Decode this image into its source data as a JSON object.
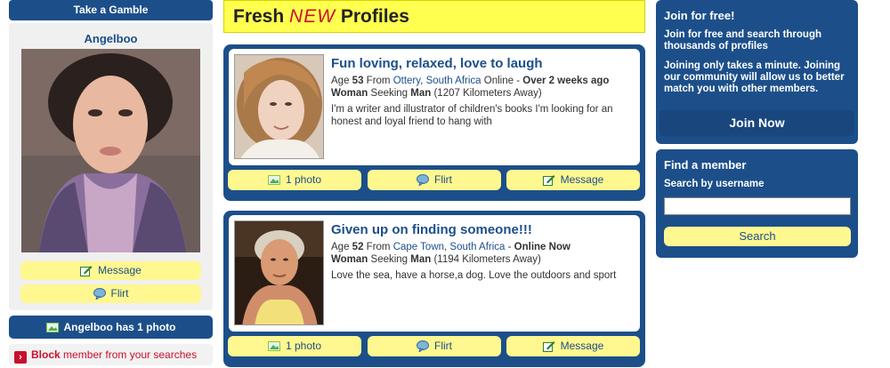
{
  "left": {
    "gamble_label": "Take a Gamble",
    "featured_name": "Angelboo",
    "message_label": "Message",
    "flirt_label": "Flirt",
    "photo_count_label": "Angelboo has 1 photo",
    "block_word": "Block",
    "block_rest": " member from your searches"
  },
  "header": {
    "fresh": "Fresh ",
    "new": "NEW",
    "profiles": " Profiles"
  },
  "profiles": [
    {
      "headline": "Fun loving, relaxed, love to laugh",
      "age_label": "Age ",
      "age": "53",
      "from_label": " From ",
      "city": "Ottery",
      "country": "South Africa",
      "online_label": " Online - ",
      "online_status": "Over 2 weeks ago",
      "gender": "Woman",
      "seeking_label": " Seeking ",
      "seeking": "Man",
      "distance": " (1207 Kilometers Away)",
      "description": "I'm a writer and illustrator of children's books I'm looking for an honest and loyal friend to hang with",
      "photo_btn": "1 photo",
      "flirt_btn": "Flirt",
      "message_btn": "Message"
    },
    {
      "headline": "Given up on finding someone!!!",
      "age_label": "Age ",
      "age": "52",
      "from_label": " From ",
      "city": "Cape Town",
      "country": "South Africa",
      "online_label": " - ",
      "online_status": "Online Now",
      "gender": "Woman",
      "seeking_label": " Seeking ",
      "seeking": "Man",
      "distance": " (1194 Kilometers Away)",
      "description": "Love the sea, have a horse,a dog. Love the outdoors and sport",
      "photo_btn": "1 photo",
      "flirt_btn": "Flirt",
      "message_btn": "Message"
    }
  ],
  "right": {
    "join_title": "Join for free!",
    "join_p1": "Join for free and search through thousands of profiles",
    "join_p2": "Joining only takes a minute. Joining our community will allow us to better match you with other members.",
    "join_button": "Join Now",
    "find_title": "Find a member",
    "find_sub": "Search by username",
    "search_input_value": "",
    "search_button": "Search"
  },
  "colors": {
    "brand_blue": "#1c4f8a",
    "button_yellow": "#fff78f",
    "header_yellow": "#ffff4f",
    "accent_red": "#c8102e"
  },
  "icons": {
    "message": "message-icon",
    "flirt": "speech-bubble-icon",
    "photo": "photo-icon",
    "block": "block-arrow-icon"
  }
}
